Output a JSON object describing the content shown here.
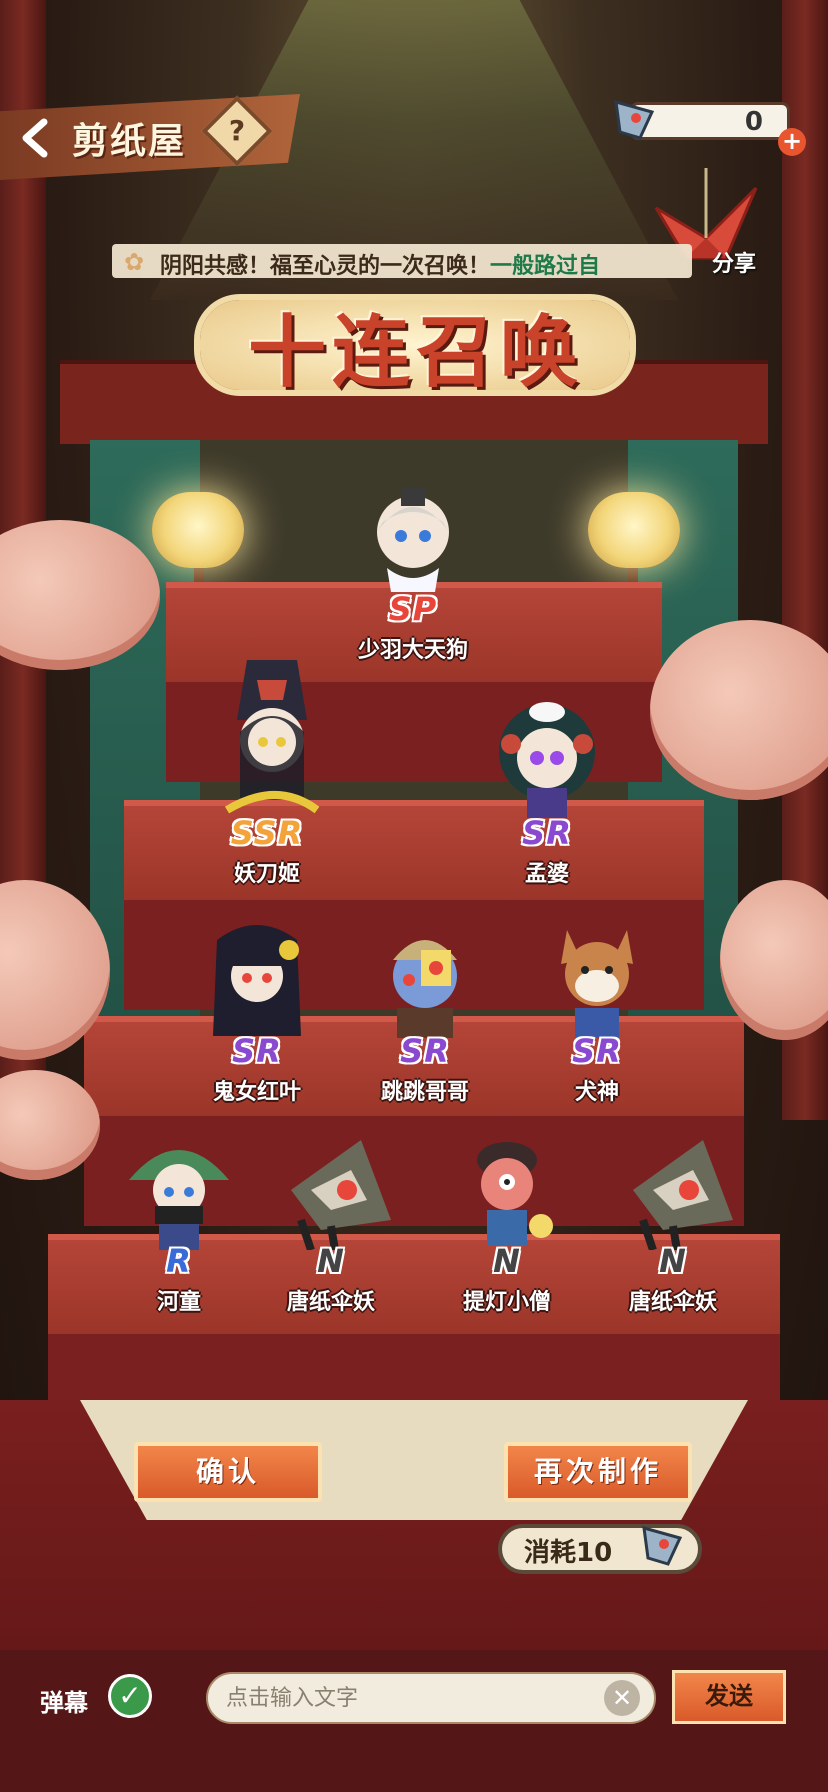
{
  "header": {
    "back_icon": "chevron-left-icon",
    "title": "剪纸屋",
    "help_label": "?"
  },
  "currency": {
    "value": "0",
    "plus_label": "+",
    "icon": "paper-shikigami-icon"
  },
  "share": {
    "label": "分享",
    "icon": "paper-crane-icon"
  },
  "subtitle": {
    "text": "阴阳共感！福至心灵的一次召唤！",
    "highlight": "一般路过自"
  },
  "main_title": "十连召唤",
  "results": [
    {
      "name": "少羽大天狗",
      "rarity": "SP"
    },
    {
      "name": "妖刀姬",
      "rarity": "SSR"
    },
    {
      "name": "孟婆",
      "rarity": "SR"
    },
    {
      "name": "鬼女红叶",
      "rarity": "SR"
    },
    {
      "name": "跳跳哥哥",
      "rarity": "SR"
    },
    {
      "name": "犬神",
      "rarity": "SR"
    },
    {
      "name": "河童",
      "rarity": "R"
    },
    {
      "name": "唐纸伞妖",
      "rarity": "N"
    },
    {
      "name": "提灯小僧",
      "rarity": "N"
    },
    {
      "name": "唐纸伞妖",
      "rarity": "N"
    }
  ],
  "buttons": {
    "confirm": "确认",
    "again": "再次制作",
    "cost": "消耗10"
  },
  "danmu": {
    "label": "弹幕",
    "check": "✓",
    "placeholder": "点击输入文字",
    "clear": "✕",
    "send": "发送"
  },
  "colors": {
    "SP": "#e8463a",
    "SSR": "#f3a33a",
    "SR": "#8a4ad0",
    "R": "#3a6ad8",
    "N": "#444444"
  }
}
